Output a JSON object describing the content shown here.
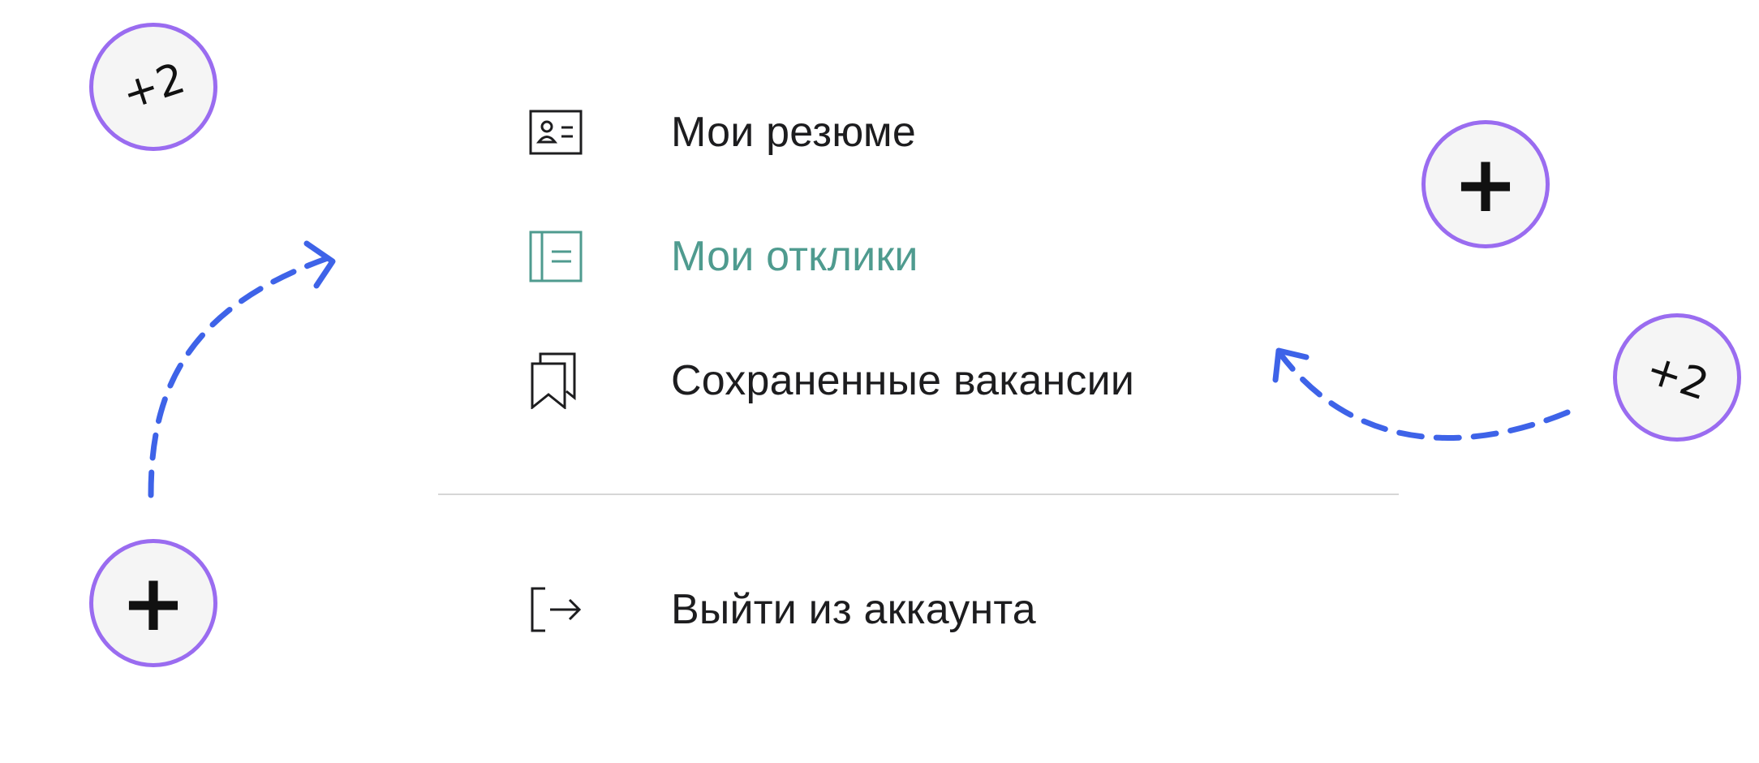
{
  "menu": {
    "items": [
      {
        "label": "Мои резюме",
        "icon": "resume-card-icon",
        "active": false
      },
      {
        "label": "Мои отклики",
        "icon": "responses-document-icon",
        "active": true
      },
      {
        "label": "Сохраненные вакансии",
        "icon": "bookmarks-icon",
        "active": false
      }
    ],
    "logout": {
      "label": "Выйти из аккаунта",
      "icon": "logout-icon"
    }
  },
  "annotations": {
    "badges": [
      {
        "text": "+2"
      },
      {
        "text": "+"
      },
      {
        "text": "+"
      },
      {
        "text": "+2"
      }
    ]
  },
  "colors": {
    "active": "#4f9b8f",
    "text": "#1d1d1f",
    "badge_border": "#9a6cf0",
    "arrow": "#3e63e8",
    "divider": "#d6d6d6"
  }
}
